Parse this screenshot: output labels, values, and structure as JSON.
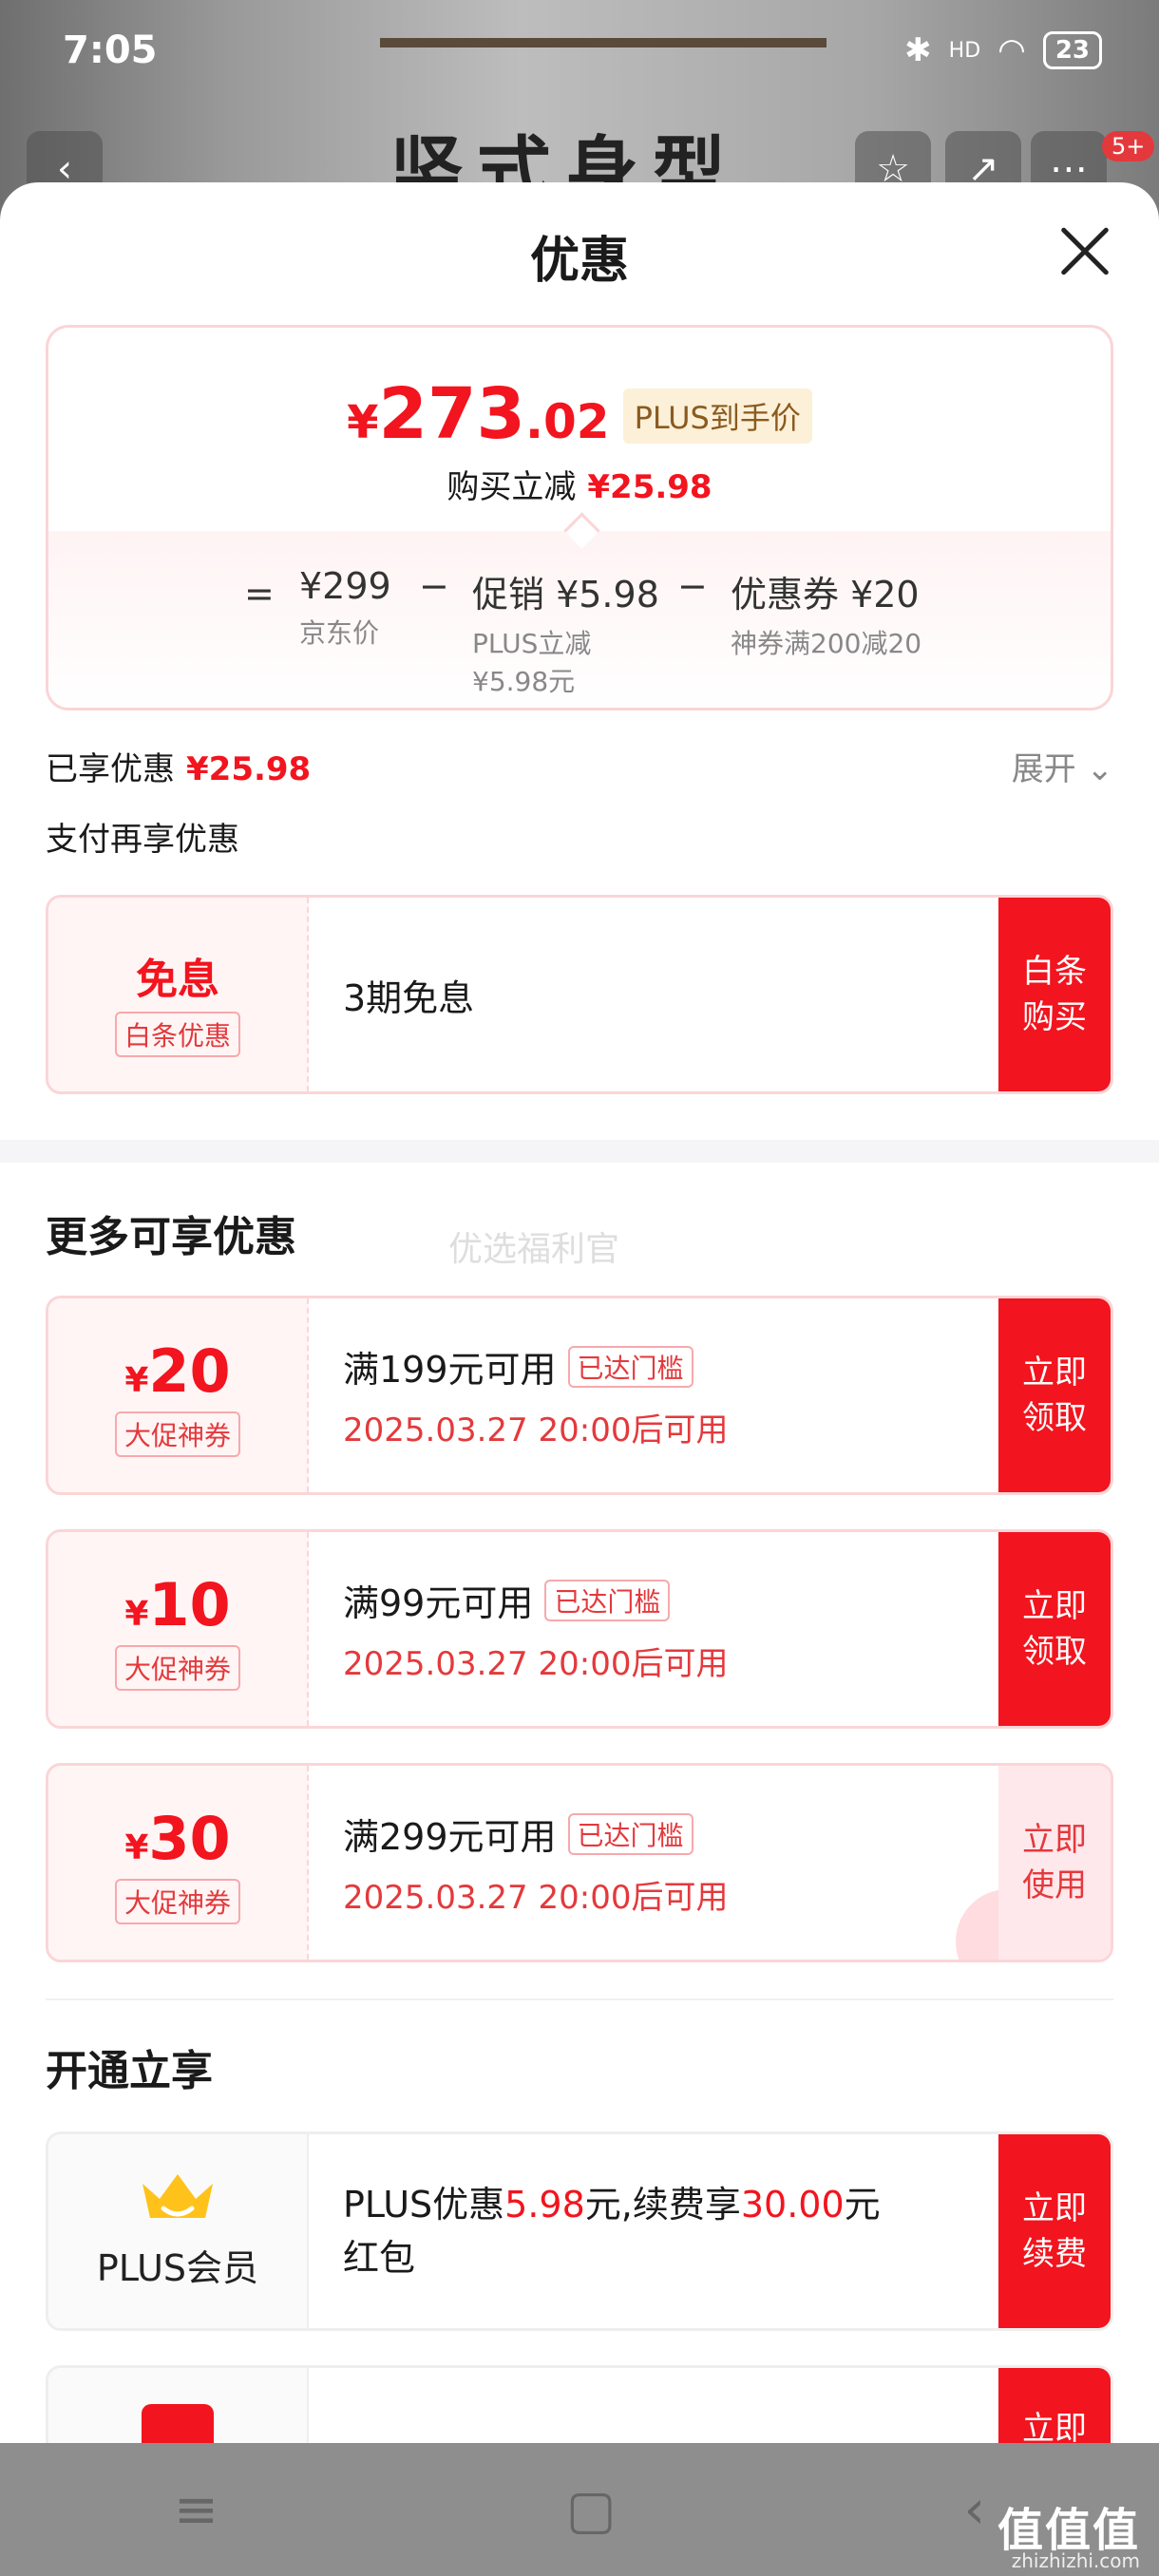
{
  "status": {
    "time": "7:05",
    "battery": "23",
    "signal_label": "HD"
  },
  "background": {
    "banner_text": "竖式身型",
    "badge": "5+"
  },
  "sheet": {
    "title": "优惠"
  },
  "price": {
    "currency": "¥",
    "int": "273",
    "dec": ".02",
    "plus_tag": "PLUS到手价",
    "reduce_label": "购买立减",
    "reduce_value": "¥25.98",
    "formula": {
      "eq": "=",
      "base_value": "¥299",
      "base_label": "京东价",
      "minus1": "−",
      "promo_value": "促销 ¥5.98",
      "promo_label": "PLUS立减\n¥5.98元",
      "minus2": "−",
      "coupon_value": "优惠券 ¥20",
      "coupon_label": "神券满200减20"
    }
  },
  "enjoyed": {
    "label": "已享优惠",
    "value": "¥25.98",
    "expand": "展开"
  },
  "pay": {
    "title": "支付再享优惠",
    "card": {
      "big": "免息",
      "tag": "白条优惠",
      "text": "3期免息",
      "action": "白条\n购买"
    }
  },
  "more": {
    "title": "更多可享优惠",
    "watermark": "优选福利官",
    "coupons": [
      {
        "yen": "¥",
        "amount": "20",
        "tag": "大促神券",
        "condition": "满199元可用",
        "reach": "已达门槛",
        "time": "2025.03.27 20:00后可用",
        "action": "立即\n领取"
      },
      {
        "yen": "¥",
        "amount": "10",
        "tag": "大促神券",
        "condition": "满99元可用",
        "reach": "已达门槛",
        "time": "2025.03.27 20:00后可用",
        "action": "立即\n领取"
      },
      {
        "yen": "¥",
        "amount": "30",
        "tag": "大促神券",
        "condition": "满299元可用",
        "reach": "已达门槛",
        "time": "2025.03.27 20:00后可用",
        "action": "立即\n使用"
      }
    ]
  },
  "open": {
    "title": "开通立享",
    "plus": {
      "label": "PLUS会员",
      "text_a": "PLUS优惠",
      "red1": "5.98",
      "text_b": "元,续费享",
      "red2": "30.00",
      "text_c": "元",
      "text_d": "红包",
      "action": "立即\n续费"
    },
    "partial_action": "立即"
  },
  "colors": {
    "accent": "#f2141e",
    "tag_bg": "#fdf0d8"
  },
  "logo": {
    "text": "值值值",
    "url": "zhizhizhi.com"
  }
}
